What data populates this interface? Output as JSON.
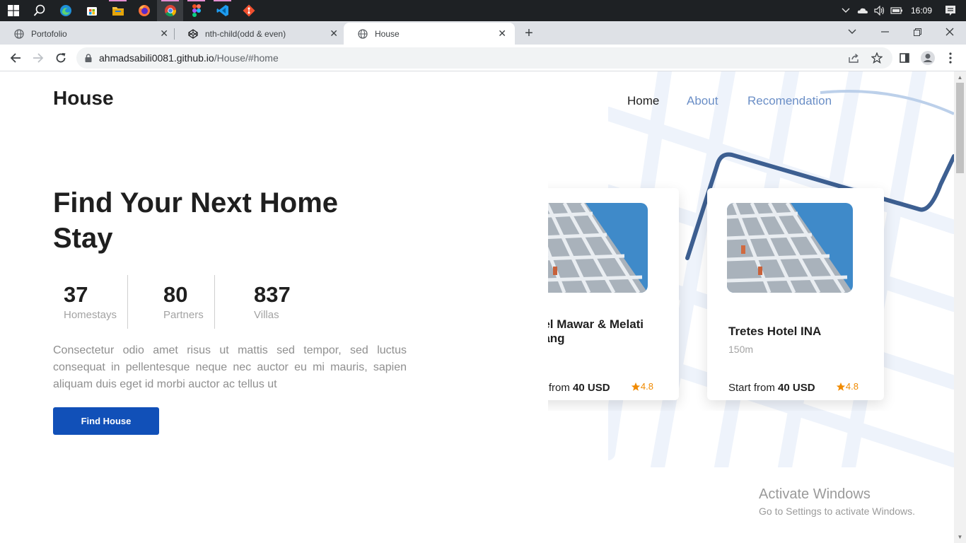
{
  "taskbar": {
    "icons": [
      "windows-start-icon",
      "search-icon",
      "edge-icon",
      "store-icon",
      "file-explorer-icon",
      "firefox-icon",
      "chrome-icon",
      "figma-icon",
      "vscode-icon",
      "git-icon"
    ],
    "clock": "16:09"
  },
  "browser": {
    "tabs": [
      {
        "title": "Portofolio"
      },
      {
        "title": "nth-child(odd & even)"
      },
      {
        "title": "House"
      }
    ],
    "url_host": "ahmadsabili0081.github.io",
    "url_path": "/House/#home"
  },
  "page": {
    "logo": "House",
    "nav": [
      "Home",
      "About",
      "Recomendation"
    ],
    "hero_title": "Find Your Next Home Stay",
    "stats": [
      {
        "value": "37",
        "label": "Homestays"
      },
      {
        "value": "80",
        "label": "Partners"
      },
      {
        "value": "837",
        "label": "Villas"
      }
    ],
    "description": "Consectetur odio amet risus ut mattis sed tempor, sed luctus consequat in pellentesque neque nec auctor eu mi mauris, sapien aliquam duis eget id morbi auctor ac tellus ut",
    "cta": "Find House",
    "cards": [
      {
        "name": "Hotel Mawar & Melati Malang",
        "distance": "",
        "price_prefix": "Start from",
        "price": "40 USD",
        "rating": "4.8"
      },
      {
        "name": "Tretes Hotel INA",
        "distance": "150m",
        "price_prefix": "Start from",
        "price": "40 USD",
        "rating": "4.8"
      }
    ]
  },
  "watermark": {
    "line1": "Activate Windows",
    "line2": "Go to Settings to activate Windows."
  },
  "colors": {
    "accent": "#1150b8",
    "nav_link": "#6a8ec6",
    "rating": "#f08a00"
  }
}
